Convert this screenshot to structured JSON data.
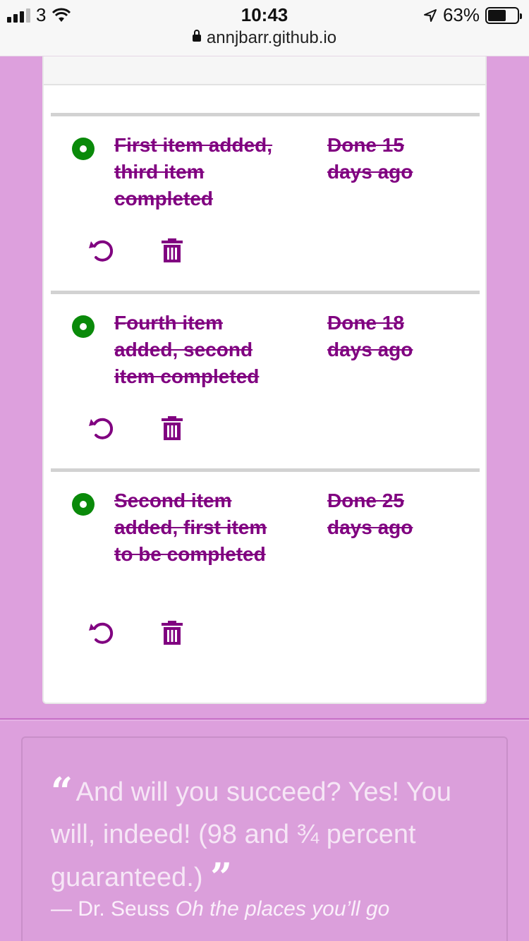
{
  "status_bar": {
    "carrier": "3",
    "time": "10:43",
    "battery": "63%",
    "url": "annjbarr.github.io"
  },
  "todos": [
    {
      "text": "First item added, third item completed",
      "done": "Done 15 days ago",
      "status_color": "#0a8a0a"
    },
    {
      "text": "Fourth item added, second item completed",
      "done": "Done 18 days ago",
      "status_color": "#0a8a0a"
    },
    {
      "text": "Second item added, first item to be completed",
      "done": "Done 25 days ago",
      "status_color": "#0a8a0a"
    }
  ],
  "quote": {
    "text": "And will you succeed? Yes! You will, indeed! (98 and ¾  percent guaranteed.)",
    "open_mark": "“",
    "close_mark": "”",
    "author": "— Dr. Seuss",
    "work": "Oh the places you’ll go"
  },
  "colors": {
    "background": "#dda0dd",
    "accent": "#800080",
    "done_indicator": "#0a8a0a"
  },
  "icons": [
    "undo-icon",
    "trash-icon",
    "lock-icon",
    "wifi-icon",
    "location-icon",
    "battery-icon"
  ]
}
